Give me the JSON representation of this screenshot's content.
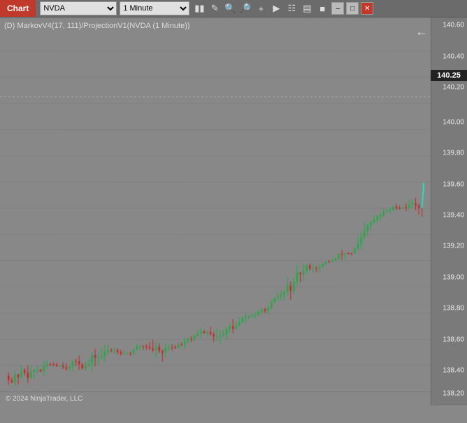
{
  "titlebar": {
    "chart_label": "Chart",
    "symbol": "NVDA",
    "timeframe": "1 Minute"
  },
  "indicator": {
    "label": "(D) MarkovV4(17, 111)/ProjectionV1(NVDA (1 Minute))"
  },
  "price_axis": {
    "levels": [
      {
        "price": "140.60",
        "pct": 2
      },
      {
        "price": "140.40",
        "pct": 10
      },
      {
        "price": "140.20",
        "pct": 18
      },
      {
        "price": "140.00",
        "pct": 27
      },
      {
        "price": "139.80",
        "pct": 35
      },
      {
        "price": "139.60",
        "pct": 43
      },
      {
        "price": "139.40",
        "pct": 51
      },
      {
        "price": "139.20",
        "pct": 59
      },
      {
        "price": "139.00",
        "pct": 67
      },
      {
        "price": "138.80",
        "pct": 75
      },
      {
        "price": "138.60",
        "pct": 83
      },
      {
        "price": "138.40",
        "pct": 91
      },
      {
        "price": "138.20",
        "pct": 97
      }
    ],
    "current_price": "140.25",
    "current_price_pct": 15
  },
  "footer": {
    "copyright": "© 2024 NinjaTrader, LLC"
  },
  "toolbar": {
    "icons": [
      "bar-chart-icon",
      "pencil-icon",
      "magnify-plus-icon",
      "magnify-minus-icon",
      "plus-icon",
      "cursor-icon",
      "layers-icon",
      "chart-type-icon",
      "color-icon",
      "minimize-icon",
      "restore-icon",
      "close-icon"
    ]
  }
}
